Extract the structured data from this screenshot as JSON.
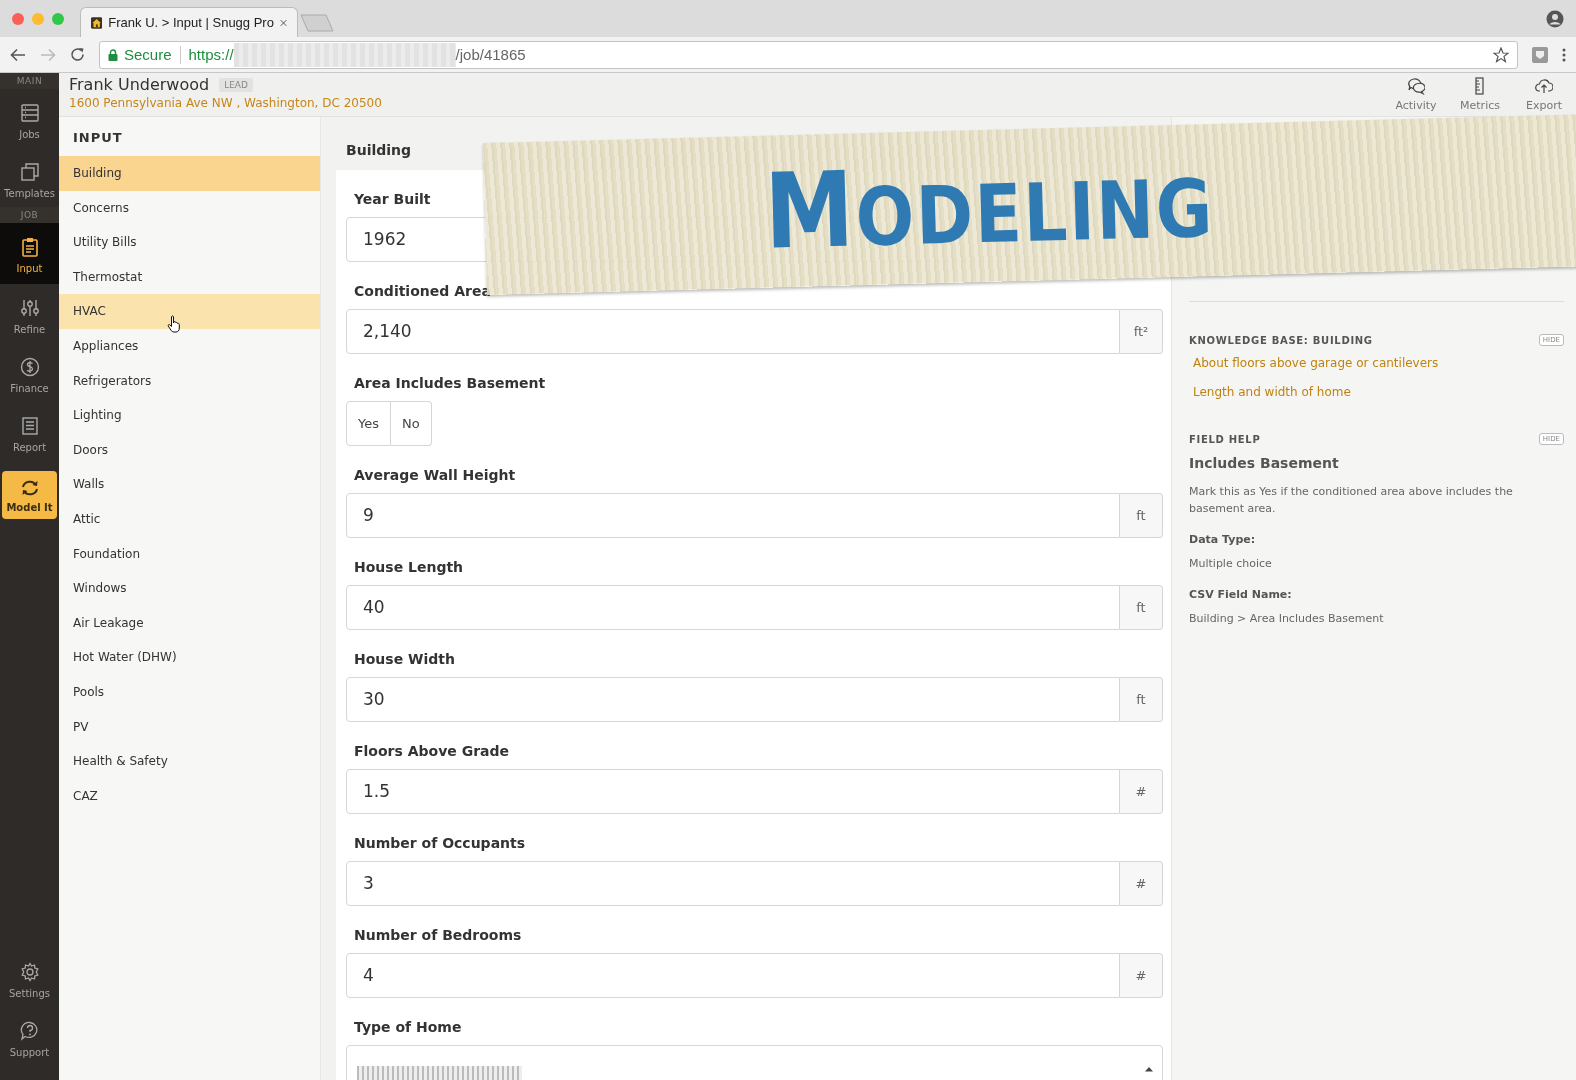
{
  "browser": {
    "tab_title": "Frank U. > Input | Snugg Pro",
    "secure_label": "Secure",
    "url_prefix": "https://",
    "url_suffix": "/job/41865"
  },
  "rail": [
    {
      "kind": "section",
      "label": "MAIN"
    },
    {
      "kind": "item",
      "label": "Jobs",
      "selected": false
    },
    {
      "kind": "item",
      "label": "Templates",
      "selected": false
    },
    {
      "kind": "section",
      "label": "JOB"
    },
    {
      "kind": "item",
      "label": "Input",
      "selected": true
    },
    {
      "kind": "item",
      "label": "Refine",
      "selected": false
    },
    {
      "kind": "item",
      "label": "Finance",
      "selected": false
    },
    {
      "kind": "item",
      "label": "Report",
      "selected": false
    },
    {
      "kind": "action",
      "label": "Model It"
    },
    {
      "kind": "bottom",
      "label": "Settings"
    },
    {
      "kind": "bottom",
      "label": "Support"
    }
  ],
  "header": {
    "name": "Frank Underwood",
    "badge": "LEAD",
    "address": "1600 Pennsylvania Ave NW , Washington, DC 20500",
    "actions": [
      {
        "label": "Activity"
      },
      {
        "label": "Metrics"
      },
      {
        "label": "Export"
      }
    ]
  },
  "sidebar": {
    "title": "INPUT",
    "items": [
      {
        "label": "Building",
        "selected": true,
        "hovered": false
      },
      {
        "label": "Concerns",
        "selected": false,
        "hovered": false
      },
      {
        "label": "Utility Bills",
        "selected": false,
        "hovered": false
      },
      {
        "label": "Thermostat",
        "selected": false,
        "hovered": false
      },
      {
        "label": "HVAC",
        "selected": false,
        "hovered": true
      },
      {
        "label": "Appliances",
        "selected": false,
        "hovered": false
      },
      {
        "label": "Refrigerators",
        "selected": false,
        "hovered": false
      },
      {
        "label": "Lighting",
        "selected": false,
        "hovered": false
      },
      {
        "label": "Doors",
        "selected": false,
        "hovered": false
      },
      {
        "label": "Walls",
        "selected": false,
        "hovered": false
      },
      {
        "label": "Attic",
        "selected": false,
        "hovered": false
      },
      {
        "label": "Foundation",
        "selected": false,
        "hovered": false
      },
      {
        "label": "Windows",
        "selected": false,
        "hovered": false
      },
      {
        "label": "Air Leakage",
        "selected": false,
        "hovered": false
      },
      {
        "label": "Hot Water (DHW)",
        "selected": false,
        "hovered": false
      },
      {
        "label": "Pools",
        "selected": false,
        "hovered": false
      },
      {
        "label": "PV",
        "selected": false,
        "hovered": false
      },
      {
        "label": "Health & Safety",
        "selected": false,
        "hovered": false
      },
      {
        "label": "CAZ",
        "selected": false,
        "hovered": false
      }
    ]
  },
  "main": {
    "title": "Building",
    "fields": [
      {
        "kind": "number",
        "label": "Year Built",
        "value": "1962"
      },
      {
        "kind": "number",
        "label": "Conditioned Area",
        "value": "2,140",
        "unit": "ft²"
      },
      {
        "kind": "choice",
        "label": "Area Includes Basement",
        "options": [
          {
            "label": "Yes",
            "selected": false
          },
          {
            "label": "No",
            "selected": false
          }
        ]
      },
      {
        "kind": "number",
        "label": "Average Wall Height",
        "value": "9",
        "unit": "ft"
      },
      {
        "kind": "number",
        "label": "House Length",
        "value": "40",
        "unit": "ft"
      },
      {
        "kind": "number",
        "label": "House Width",
        "value": "30",
        "unit": "ft"
      },
      {
        "kind": "number",
        "label": "Floors Above Grade",
        "value": "1.5",
        "unit": "#"
      },
      {
        "kind": "number",
        "label": "Number of Occupants",
        "value": "3",
        "unit": "#"
      },
      {
        "kind": "number",
        "label": "Number of Bedrooms",
        "value": "4",
        "unit": "#"
      },
      {
        "kind": "select",
        "label": "Type of Home"
      }
    ]
  },
  "help_panel": {
    "knowledge_base": {
      "title": "KNOWLEDGE BASE: BUILDING",
      "hide_label": "HIDE",
      "links": [
        "About floors above garage or cantilevers",
        "Length and width of home"
      ]
    },
    "field_help": {
      "title": "FIELD HELP",
      "hide_label": "HIDE",
      "heading": "Includes Basement",
      "description": "Mark this as Yes if the conditioned area above includes the basement area.",
      "details": [
        {
          "label": "Data Type:",
          "value": "Multiple choice"
        },
        {
          "label": "CSV Field Name:",
          "value": "Building > Area Includes Basement"
        }
      ]
    }
  },
  "overlay_banner": {
    "text": "MODELING"
  }
}
